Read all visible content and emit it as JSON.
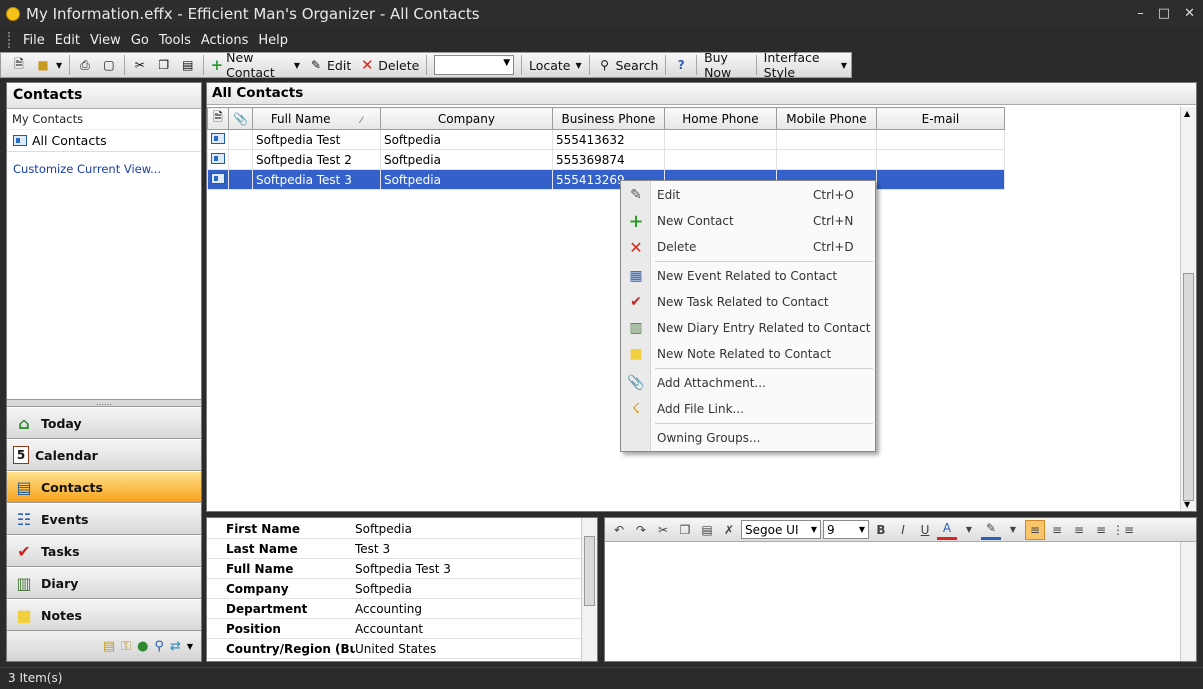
{
  "window": {
    "title": "My Information.effx - Efficient Man's Organizer - All Contacts",
    "controls": [
      "–",
      "□",
      "✕"
    ]
  },
  "menubar": {
    "items": [
      "File",
      "Edit",
      "View",
      "Go",
      "Tools",
      "Actions",
      "Help"
    ]
  },
  "toolbar": {
    "new_contact": "New Contact",
    "edit": "Edit",
    "delete": "Delete",
    "combo_value": "",
    "locate": "Locate",
    "search": "Search",
    "buy_now": "Buy Now",
    "interface_style": "Interface Style"
  },
  "left_panel": {
    "header": "Contacts",
    "group": "My Contacts",
    "folder": "All Contacts",
    "customize_link": "Customize Current View...",
    "nav": [
      {
        "label": "Today",
        "icon": "house-icon",
        "glyph": "⌂"
      },
      {
        "label": "Calendar",
        "icon": "calendar-icon",
        "glyph": "5"
      },
      {
        "label": "Contacts",
        "icon": "contact-card-icon",
        "glyph": "▤"
      },
      {
        "label": "Events",
        "icon": "events-icon",
        "glyph": "☷"
      },
      {
        "label": "Tasks",
        "icon": "checkmark-icon",
        "glyph": "✔"
      },
      {
        "label": "Diary",
        "icon": "diary-icon",
        "glyph": "▥"
      },
      {
        "label": "Notes",
        "icon": "note-icon",
        "glyph": "■"
      }
    ],
    "active_nav": "Contacts"
  },
  "grid": {
    "header": "All Contacts",
    "columns": [
      "Full Name",
      "Company",
      "Business Phone",
      "Home Phone",
      "Mobile Phone",
      "E-mail"
    ],
    "rows": [
      {
        "full_name": "Softpedia Test",
        "company": "Softpedia",
        "business_phone": "555413632",
        "home_phone": "",
        "mobile_phone": "",
        "email": ""
      },
      {
        "full_name": "Softpedia Test 2",
        "company": "Softpedia",
        "business_phone": "555369874",
        "home_phone": "",
        "mobile_phone": "",
        "email": ""
      },
      {
        "full_name": "Softpedia Test 3",
        "company": "Softpedia",
        "business_phone": "555413269",
        "home_phone": "",
        "mobile_phone": "",
        "email": ""
      }
    ],
    "selected_row": 2
  },
  "context_menu": {
    "items": [
      {
        "label": "Edit",
        "shortcut": "Ctrl+O",
        "icon": "edit-pencil-icon"
      },
      {
        "label": "New Contact",
        "shortcut": "Ctrl+N",
        "icon": "plus-icon"
      },
      {
        "label": "Delete",
        "shortcut": "Ctrl+D",
        "icon": "delete-x-icon"
      },
      {
        "label": "New Event Related to Contact",
        "shortcut": "",
        "icon": "event-icon"
      },
      {
        "label": "New Task Related to Contact",
        "shortcut": "",
        "icon": "task-icon"
      },
      {
        "label": "New Diary Entry Related to Contact",
        "shortcut": "",
        "icon": "diary-icon"
      },
      {
        "label": "New Note Related to Contact",
        "shortcut": "",
        "icon": "note-icon"
      },
      {
        "label": "Add Attachment...",
        "shortcut": "",
        "icon": "paperclip-icon"
      },
      {
        "label": "Add File Link...",
        "shortcut": "",
        "icon": "file-link-icon"
      },
      {
        "label": "Owning Groups...",
        "shortcut": "",
        "icon": ""
      }
    ]
  },
  "details": {
    "fields": [
      {
        "label": "First Name",
        "value": "Softpedia"
      },
      {
        "label": "Last Name",
        "value": "Test 3"
      },
      {
        "label": "Full Name",
        "value": "Softpedia Test 3"
      },
      {
        "label": "Company",
        "value": "Softpedia"
      },
      {
        "label": "Department",
        "value": "Accounting"
      },
      {
        "label": "Position",
        "value": "Accountant"
      },
      {
        "label": "Country/Region (Business)",
        "value": "United States"
      }
    ]
  },
  "note_editor": {
    "font_name": "Segoe UI",
    "font_size": "9",
    "bold": "B",
    "italic": "I",
    "underline": "U"
  },
  "statusbar": {
    "text": "3 Item(s)"
  },
  "colors": {
    "selection": "#3361c9",
    "active_nav": "#f7a21c",
    "chrome": "#2b2b2b"
  }
}
